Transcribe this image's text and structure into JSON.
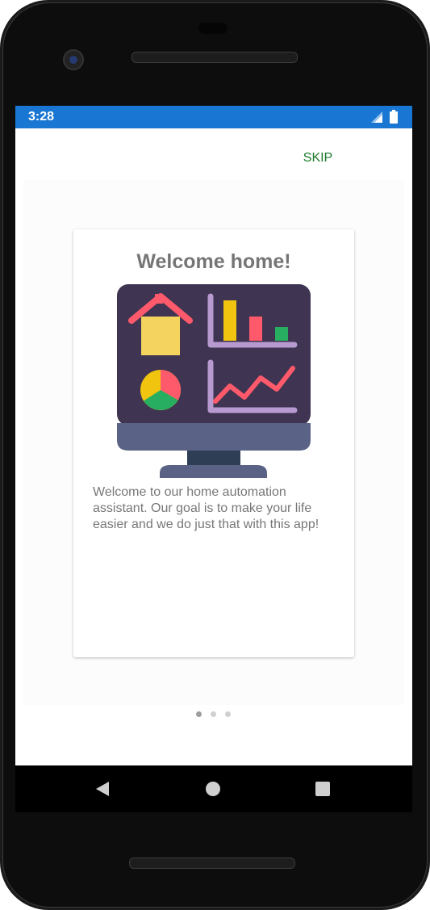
{
  "status": {
    "time": "3:28"
  },
  "header": {
    "skip_label": "SKIP"
  },
  "onboarding": {
    "title": "Welcome home!",
    "description": "Welcome to our home automation assistant. Our goal is to make your life easier and we do just that with this app!",
    "page_count": 3,
    "active_page": 1
  },
  "colors": {
    "status_bar": "#1976d2",
    "skip_text": "#1b7a2a",
    "title_text": "#757575",
    "monitor_screen": "#3f3451",
    "house": "#f4d35e",
    "roof": "#ff5a6b"
  },
  "icons": {
    "signal": "signal-icon",
    "battery": "battery-icon",
    "back": "back-triangle-icon",
    "home": "home-circle-icon",
    "recents": "recents-square-icon"
  }
}
